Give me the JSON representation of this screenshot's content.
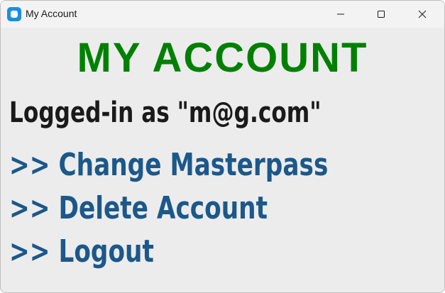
{
  "window": {
    "title": "My Account",
    "controls": {
      "minimize_icon": "minimize-icon",
      "maximize_icon": "maximize-icon",
      "close_icon": "close-icon"
    }
  },
  "main": {
    "heading": "MY ACCOUNT",
    "logged_in_text": "Logged-in as \"m@g.com\"",
    "links": [
      ">> Change Masterpass",
      ">> Delete Account",
      ">> Logout"
    ]
  },
  "colors": {
    "heading": "#008000",
    "link": "#1c5889",
    "text": "#1a1a1a",
    "background": "#ececed"
  }
}
